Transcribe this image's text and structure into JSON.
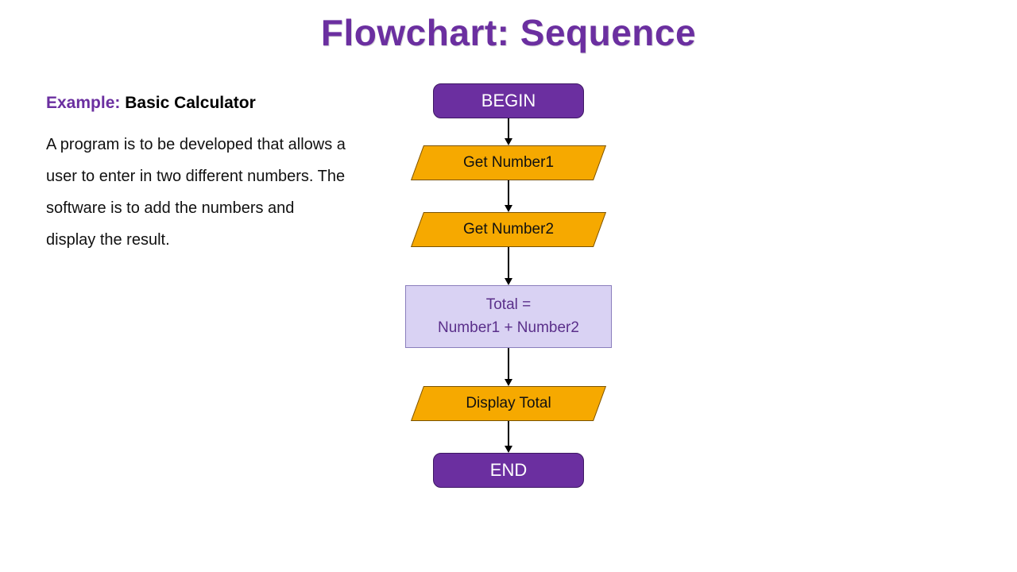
{
  "title": "Flowchart: Sequence",
  "example": {
    "label": "Example:",
    "name": "Basic Calculator",
    "description": "A program is to be developed that allows a user to enter in two different numbers. The software is to add the numbers and display the result."
  },
  "flow": {
    "begin": "BEGIN",
    "step1": "Get Number1",
    "step2": "Get Number2",
    "step3_line1": "Total =",
    "step3_line2": "Number1 + Number2",
    "step4": "Display Total",
    "end": "END"
  }
}
